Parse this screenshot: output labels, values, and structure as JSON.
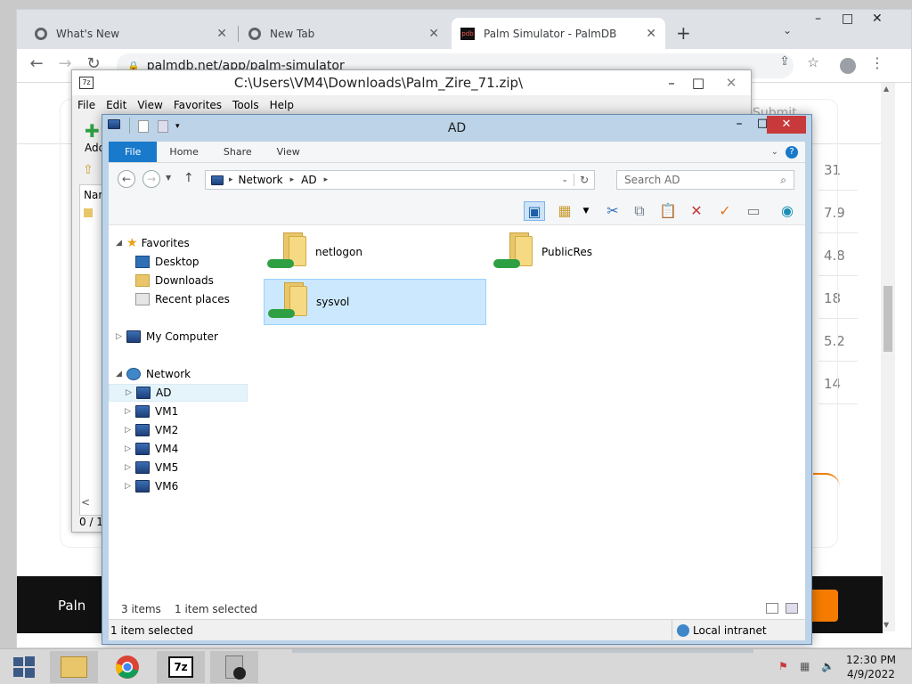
{
  "browser": {
    "tabs": [
      {
        "label": "What's New",
        "close": "✕"
      },
      {
        "label": "New Tab",
        "close": "✕"
      },
      {
        "label": "Palm Simulator - PalmDB",
        "close": "✕",
        "active": true
      }
    ],
    "new_tab_symbol": "+",
    "url": "palmdb.net/app/palm-simulator",
    "lock_icon": "lock-icon",
    "window_controls": [
      "–",
      "□",
      "✕"
    ]
  },
  "website": {
    "submit_label": "Submit",
    "sidebar_values": [
      "31",
      "7.9",
      "4.8",
      "18",
      "5.2",
      "14"
    ],
    "footer_text": "Paln"
  },
  "sevenzip": {
    "title": "C:\\Users\\VM4\\Downloads\\Palm_Zire_71.zip\\",
    "menu": [
      "File",
      "Edit",
      "View",
      "Favorites",
      "Tools",
      "Help"
    ],
    "add_label": "Add",
    "column_name": "Nar",
    "status": "0 / 1",
    "window_controls": [
      "–",
      "□",
      "✕"
    ]
  },
  "explorer": {
    "title": "AD",
    "ribbon_tabs": [
      "File",
      "Home",
      "Share",
      "View"
    ],
    "breadcrumb": [
      "Network",
      "AD"
    ],
    "search_placeholder": "Search AD",
    "nav": {
      "favorites": "Favorites",
      "favorites_items": [
        "Desktop",
        "Downloads",
        "Recent places"
      ],
      "my_computer": "My Computer",
      "network": "Network",
      "network_items": [
        "AD",
        "VM1",
        "VM2",
        "VM4",
        "VM5",
        "VM6"
      ]
    },
    "folders": [
      {
        "name": "netlogon"
      },
      {
        "name": "PublicRes"
      },
      {
        "name": "sysvol",
        "selected": true
      }
    ],
    "item_count": "3 items",
    "selection_status": "1 item selected",
    "statusbar_left": "1 item selected",
    "zone": "Local intranet",
    "window_controls": [
      "–",
      "□",
      "✕"
    ]
  },
  "taskbar": {
    "time": "12:30 PM",
    "date": "4/9/2022",
    "apps": [
      "windows-start",
      "file-explorer",
      "chrome",
      "7-zip",
      "palm-simulator"
    ]
  },
  "colors": {
    "ribbon_file": "#1979ca",
    "selection_bg": "#cce8ff",
    "titlebar_close": "#c7393a",
    "explorer_frame": "#bcd3e8"
  }
}
